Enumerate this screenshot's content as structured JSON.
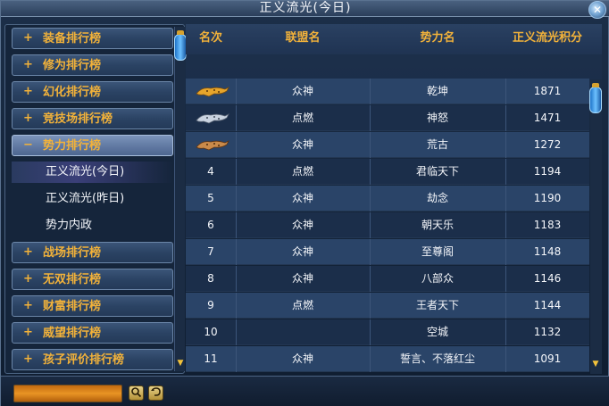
{
  "window": {
    "title": "正义流光(今日)",
    "close_label": "✕"
  },
  "sidebar": {
    "categories_top": [
      {
        "plus": "+",
        "label": "装备排行榜"
      },
      {
        "plus": "+",
        "label": "修为排行榜"
      },
      {
        "plus": "+",
        "label": "幻化排行榜"
      },
      {
        "plus": "+",
        "label": "竞技场排行榜"
      }
    ],
    "active_category": {
      "plus": "−",
      "label": "势力排行榜"
    },
    "subitems": [
      {
        "label": "正义流光(今日)",
        "selected": true
      },
      {
        "label": "正义流光(昨日)",
        "selected": false
      },
      {
        "label": "势力内政",
        "selected": false
      }
    ],
    "categories_bottom": [
      {
        "plus": "+",
        "label": "战场排行榜"
      },
      {
        "plus": "+",
        "label": "无双排行榜"
      },
      {
        "plus": "+",
        "label": "财富排行榜"
      },
      {
        "plus": "+",
        "label": "威望排行榜"
      },
      {
        "plus": "+",
        "label": "孩子评价排行榜"
      }
    ]
  },
  "table": {
    "headers": {
      "rank": "名次",
      "alliance": "联盟名",
      "faction": "势力名",
      "score": "正义流光积分"
    },
    "rows": [
      {
        "rank": "",
        "rank_icon": "gold-leopard-icon",
        "alliance": "众神",
        "faction": "乾坤",
        "score": "1871"
      },
      {
        "rank": "",
        "rank_icon": "silver-leopard-icon",
        "alliance": "点燃",
        "faction": "神怒",
        "score": "1471"
      },
      {
        "rank": "",
        "rank_icon": "bronze-leopard-icon",
        "alliance": "众神",
        "faction": "荒古",
        "score": "1272"
      },
      {
        "rank": "4",
        "rank_icon": "",
        "alliance": "点燃",
        "faction": "君临天下",
        "score": "1194"
      },
      {
        "rank": "5",
        "rank_icon": "",
        "alliance": "众神",
        "faction": "劫念",
        "score": "1190"
      },
      {
        "rank": "6",
        "rank_icon": "",
        "alliance": "众神",
        "faction": "朝天乐",
        "score": "1183"
      },
      {
        "rank": "7",
        "rank_icon": "",
        "alliance": "众神",
        "faction": "至尊阁",
        "score": "1148"
      },
      {
        "rank": "8",
        "rank_icon": "",
        "alliance": "众神",
        "faction": "八部众",
        "score": "1146"
      },
      {
        "rank": "9",
        "rank_icon": "",
        "alliance": "点燃",
        "faction": "王者天下",
        "score": "1144"
      },
      {
        "rank": "10",
        "rank_icon": "",
        "alliance": "",
        "faction": "空城",
        "score": "1132"
      },
      {
        "rank": "11",
        "rank_icon": "",
        "alliance": "众神",
        "faction": "誓言、不落红尘",
        "score": "1091"
      }
    ]
  },
  "bottom": {
    "search_value": "",
    "search_icon": "magnifier-icon",
    "reset_icon": "return-arrow-icon"
  },
  "colors": {
    "accent_gold": "#f2b23a",
    "row_light": "#2a4468",
    "row_dark": "#1b2e4a"
  }
}
